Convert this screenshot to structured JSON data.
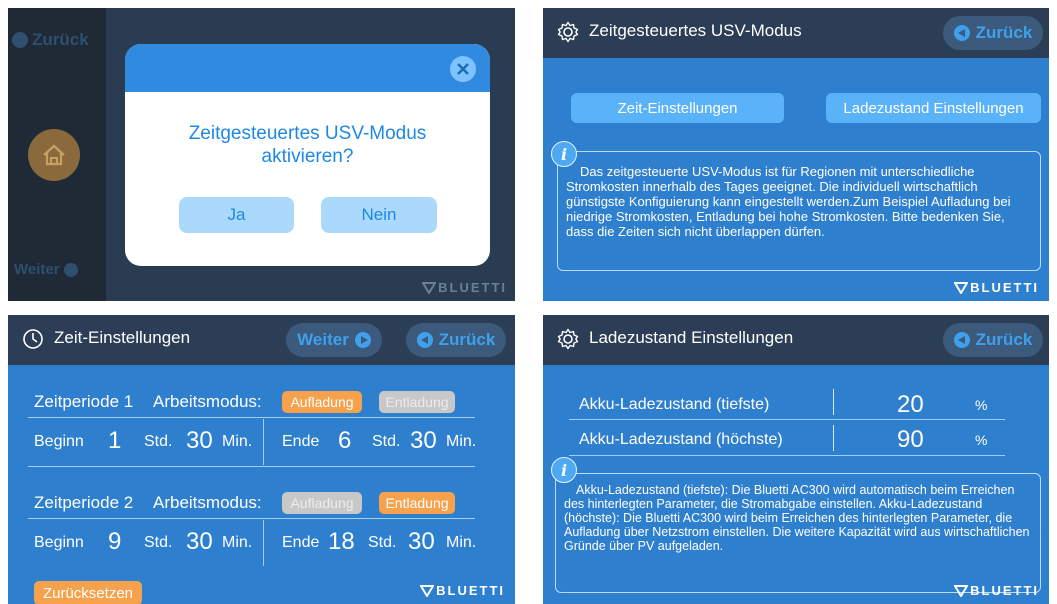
{
  "panel1": {
    "back_label": "Zurück",
    "next_label": "Weiter",
    "dialog_text": "Zeitgesteuertes USV-Modus aktivieren?",
    "yes_label": "Ja",
    "no_label": "Nein",
    "brand": "BLUETTI"
  },
  "panel2": {
    "title": "Zeitgesteuertes USV-Modus",
    "back_label": "Zurück",
    "time_settings_label": "Zeit-Einstellungen",
    "charge_settings_label": "Ladezustand Einstellungen",
    "info_text": "Das zeitgesteuerte USV-Modus ist für Regionen mit unterschiedliche Stromkosten innerhalb des Tages  geeignet. Die individuell wirtschaftlich günstigste Konfiguierung kann eingestellt werden.Zum Beispiel Aufladung bei niedrige Stromkosten, Entladung bei hohe Stromkosten. Bitte bedenken Sie, dass die Zeiten sich nicht überlappen dürfen.",
    "brand": "BLUETTI"
  },
  "panel3": {
    "title": "Zeit-Einstellungen",
    "next_label": "Weiter",
    "back_label": "Zurück",
    "periods": [
      {
        "label": "Zeitperiode 1",
        "mode_label": "Arbeitsmodus:",
        "charge_label": "Aufladung",
        "discharge_label": "Entladung",
        "active": "charge",
        "begin_label": "Beginn",
        "begin_h": "1",
        "begin_m": "30",
        "end_label": "Ende",
        "end_h": "6",
        "end_m": "30"
      },
      {
        "label": "Zeitperiode 2",
        "mode_label": "Arbeitsmodus:",
        "charge_label": "Aufladung",
        "discharge_label": "Entladung",
        "active": "discharge",
        "begin_label": "Beginn",
        "begin_h": "9",
        "begin_m": "30",
        "end_label": "Ende",
        "end_h": "18",
        "end_m": "30"
      }
    ],
    "hour_unit": "Std.",
    "min_unit": "Min.",
    "reset_label": "Zurücksetzen",
    "brand": "BLUETTI"
  },
  "panel4": {
    "title": "Ladezustand Einstellungen",
    "back_label": "Zurück",
    "rows": [
      {
        "label": "Akku-Ladezustand (tiefste)",
        "value": "20",
        "unit": "%"
      },
      {
        "label": "Akku-Ladezustand (höchste)",
        "value": "90",
        "unit": "%"
      }
    ],
    "info_text": "Akku-Ladezustand (tiefste): Die Bluetti AC300 wird automatisch beim Erreichen des hinterlegten Parameter, die Stromabgabe einstellen. Akku-Ladezustand (höchste): Die Bluetti AC300 wird beim Erreichen des hinterlegten Parameter, die Aufladung über Netzstrom einstellen. Die weitere Kapazität wird aus wirtschaftlichen Gründe über PV aufgeladen.",
    "brand": "BLUETTI"
  }
}
